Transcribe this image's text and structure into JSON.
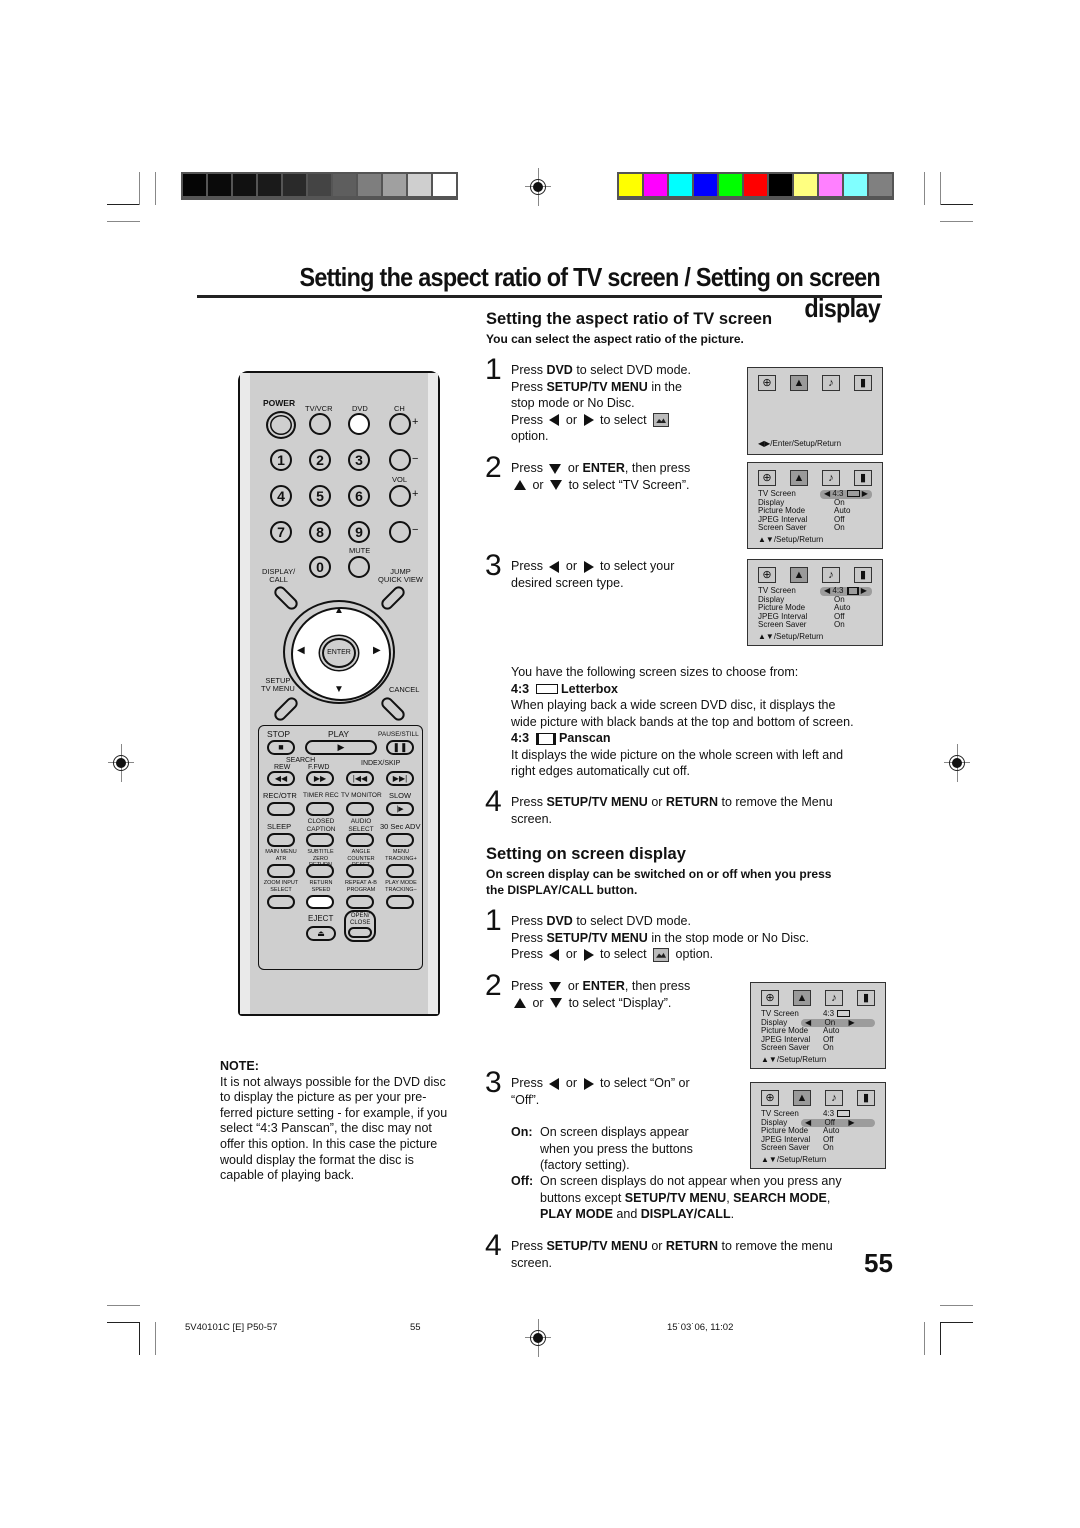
{
  "print_marks": {
    "grayscale_bars": [
      "#050505",
      "#0a0a0a",
      "#111111",
      "#1a1a1a",
      "#2a2a2a",
      "#444444",
      "#5e5e5e",
      "#7e7e7e",
      "#a0a0a0",
      "#cfcfcf",
      "#ffffff"
    ],
    "color_bars": [
      "#ffff00",
      "#ff00ff",
      "#00ffff",
      "#0000ff",
      "#00ff00",
      "#ff0000",
      "#000000",
      "#ffff80",
      "#ff80ff",
      "#80ffff",
      "#808080"
    ]
  },
  "page_title": "Setting the aspect ratio of TV screen / Setting on screen display",
  "section1": {
    "heading": "Setting the aspect ratio of TV screen",
    "subheading": "You can select the aspect ratio of the picture.",
    "steps": [
      {
        "num": "1",
        "lines": [
          "Press |DVD| to select DVD mode.",
          "Press |SETUP/TV MENU| in the",
          "stop mode or No Disc.",
          "Press ◀ or ▶ to select [pic]",
          "option."
        ]
      },
      {
        "num": "2",
        "lines": [
          "Press ▼ or |ENTER|, then press",
          "▲ or ▼ to select “TV Screen”."
        ]
      },
      {
        "num": "3",
        "lines": [
          "Press ◀ or ▶ to select your",
          "desired screen type."
        ]
      },
      {
        "num": "4",
        "lines": [
          "Press |SETUP/TV MENU| or |RETURN| to remove the Menu",
          "screen."
        ]
      }
    ],
    "step1": {
      "a1": "Press ",
      "b1": "DVD",
      "c1": " to select DVD mode.",
      "a2": "Press ",
      "b2": "SETUP/TV MENU",
      "c2": " in the",
      "l3": "stop mode or No Disc.",
      "a4": "Press",
      "or": "or",
      "to_select": "to select",
      "l5": "option."
    },
    "step2": {
      "a1": "Press",
      "or_enter": "or",
      "b1": "ENTER",
      "c1": ", then press",
      "or2": "or",
      "c2": "to select “TV Screen”."
    },
    "step3": {
      "a1": "Press",
      "or": "or",
      "c1": "to select your",
      "l2": "desired screen type."
    },
    "sizes_intro": "You have the following screen sizes to choose from:",
    "letterbox": {
      "ratio": "4:3",
      "name": "Letterbox",
      "desc1": "When playing back a wide screen DVD disc, it displays the",
      "desc2": "wide picture with black bands at the top and bottom of screen."
    },
    "panscan": {
      "ratio": "4:3",
      "name": "Panscan",
      "desc1": "It displays the wide picture on the whole screen with left and",
      "desc2": "right edges automatically cut off."
    },
    "step4": {
      "a1": "Press ",
      "b1": "SETUP/TV MENU",
      "c1": " or ",
      "b2": "RETURN",
      "c2": " to remove the Menu",
      "l2": "screen."
    }
  },
  "section2": {
    "heading": "Setting on screen display",
    "subheading1": "On screen display can be switched on or off when you press",
    "subheading2": "the DISPLAY/CALL button.",
    "step1": {
      "a1": "Press ",
      "b1": "DVD",
      "c1": " to select DVD mode.",
      "a2": "Press ",
      "b2": "SETUP/TV MENU",
      "c2": " in the stop mode or No Disc.",
      "a3": "Press",
      "or": "or",
      "to_select": "to select",
      "c3": "option."
    },
    "step2": {
      "a1": "Press",
      "or": "or",
      "b1": "ENTER",
      "c1": ", then press",
      "or2": "or",
      "c2": "to select “Display”."
    },
    "step3": {
      "a1": "Press",
      "or": "or",
      "c1": "to select “On” or",
      "l2": "“Off”."
    },
    "on": {
      "label": "On:",
      "l1": "On screen displays appear",
      "l2": "when you press the buttons",
      "l3": "(factory setting)."
    },
    "off": {
      "label": "Off:",
      "l1": "On screen displays do not appear when you press any",
      "l2a": "buttons except ",
      "b1": "SETUP/TV MENU",
      "sep1": ", ",
      "b2": "SEARCH MODE",
      "sep2": ",",
      "b3": "PLAY MODE",
      "and": " and ",
      "b4": "DISPLAY/CALL",
      "end": "."
    },
    "step4": {
      "a1": "Press ",
      "b1": "SETUP/TV MENU",
      "c1": " or ",
      "b2": "RETURN",
      "c2": " to remove the menu",
      "l2": "screen."
    }
  },
  "osd": {
    "nav_hint": "◀▶/Enter/Setup/Return",
    "footer": "▲▼/Setup/Return",
    "labels": [
      "TV Screen",
      "Display",
      "Picture Mode",
      "JPEG Interval",
      "Screen Saver"
    ],
    "screen2_values": [
      "4:3",
      "On",
      "Auto",
      "Off",
      "On"
    ],
    "screen3_values": [
      "4:3",
      "On",
      "Auto",
      "Off",
      "On"
    ],
    "screen4_values": [
      "4:3",
      "On",
      "Auto",
      "Off",
      "On"
    ],
    "screen5_values": [
      "4:3",
      "Off",
      "Auto",
      "Off",
      "On"
    ],
    "icons": [
      "language-globe-icon",
      "picture-icon",
      "audio-icon",
      "parental-settings-icon"
    ]
  },
  "remote": {
    "power": "POWER",
    "tvvcr": "TV/VCR",
    "dvd": "DVD",
    "ch": "CH",
    "digits": [
      "1",
      "2",
      "3",
      "4",
      "5",
      "6",
      "7",
      "8",
      "9",
      "0"
    ],
    "vol": "VOL",
    "mute": "MUTE",
    "display_call": [
      "DISPLAY/",
      "CALL"
    ],
    "jump": [
      "JUMP",
      "QUICK VIEW"
    ],
    "enter": "ENTER",
    "setup": [
      "SETUP",
      "TV MENU"
    ],
    "cancel": "CANCEL",
    "stop": "STOP",
    "play": "PLAY",
    "pause": "PAUSE/STILL",
    "search": "SEARCH",
    "rew": "REW",
    "ffwd": "F.FWD",
    "index_skip": "INDEX/SKIP",
    "row4": [
      "REC/OTR",
      "TIMER REC",
      "TV MONITOR",
      "SLOW"
    ],
    "row5": [
      "SLEEP",
      "CLOSED CAPTION",
      "AUDIO SELECT",
      "30 Sec ADV"
    ],
    "row6": [
      "MAIN MENU ATR",
      "SUBTITLE ZERO RETURN",
      "ANGLE COUNTER RESET",
      "MENU TRACKING+"
    ],
    "row7": [
      "ZOOM INPUT SELECT",
      "RETURN SPEED",
      "REPEAT A-B PROGRAM",
      "PLAY MODE TRACKING−"
    ],
    "eject": "EJECT",
    "open_close": [
      "OPEN/",
      "CLOSE"
    ]
  },
  "note": {
    "title": "NOTE:",
    "lines": [
      "It is not always possible for the DVD disc",
      "to display the picture as per your pre-",
      "ferred picture setting - for example, if you",
      "select “4:3 Panscan”, the disc may not",
      "offer this option. In this case the picture",
      "would display the format the disc is",
      "capable of playing back."
    ]
  },
  "page_number": "55",
  "footer": {
    "code": "5V40101C [E] P50-57",
    "page": "55",
    "date": "15˙03˙06, 11:02"
  }
}
